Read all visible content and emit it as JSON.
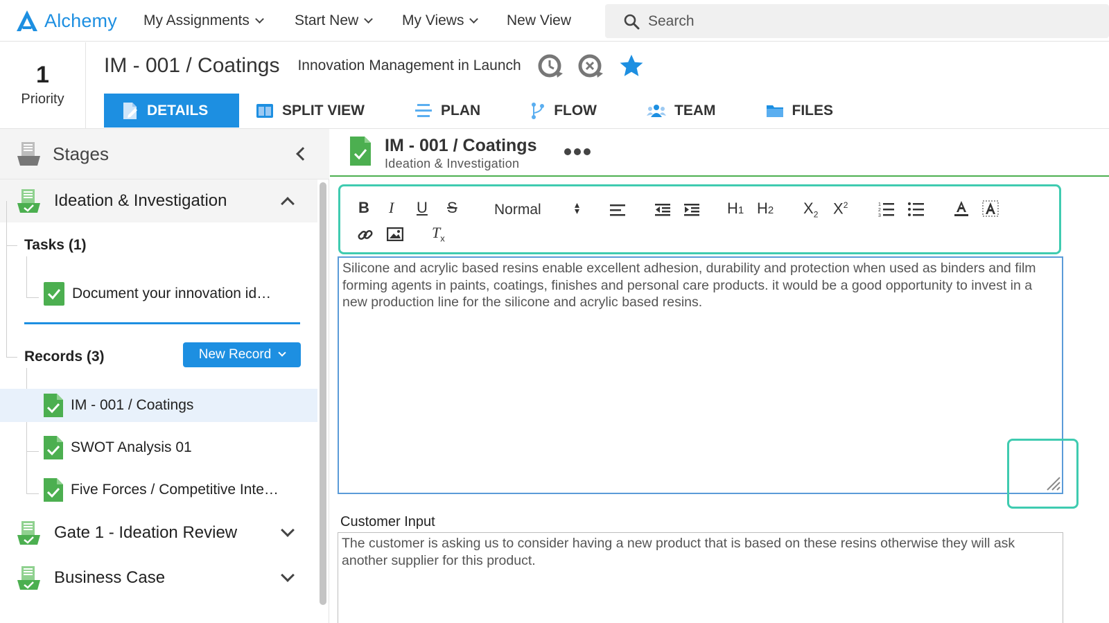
{
  "app": {
    "name": "Alchemy",
    "brand_color": "#1d8fe1"
  },
  "nav": {
    "items": [
      {
        "label": "My Assignments",
        "dropdown": true
      },
      {
        "label": "Start New",
        "dropdown": true
      },
      {
        "label": "My Views",
        "dropdown": true
      },
      {
        "label": "New View",
        "dropdown": false
      }
    ],
    "search_placeholder": "Search"
  },
  "header": {
    "priority_value": "1",
    "priority_label": "Priority",
    "title": "IM - 001 / Coatings",
    "subtitle": "Innovation Management in Launch",
    "icons": [
      "history-clock-icon",
      "cancel-clock-icon",
      "favorite-star-icon"
    ]
  },
  "tabs": [
    {
      "label": "DETAILS",
      "icon": "details-icon",
      "active": true
    },
    {
      "label": "SPLIT VIEW",
      "icon": "split-view-icon",
      "active": false
    },
    {
      "label": "PLAN",
      "icon": "plan-icon",
      "active": false
    },
    {
      "label": "FLOW",
      "icon": "flow-icon",
      "active": false
    },
    {
      "label": "TEAM",
      "icon": "team-icon",
      "active": false
    },
    {
      "label": "FILES",
      "icon": "folder-icon",
      "active": false
    }
  ],
  "sidebar": {
    "title": "Stages",
    "stages": [
      {
        "label": "Ideation & Investigation",
        "expanded": true
      },
      {
        "label": "Gate 1 - Ideation Review",
        "expanded": false
      },
      {
        "label": "Business Case",
        "expanded": false
      }
    ],
    "tasks_label": "Tasks (1)",
    "tasks": [
      {
        "label": "Document your innovation id…"
      }
    ],
    "records_label": "Records (3)",
    "new_record_label": "New Record",
    "records": [
      {
        "label": "IM - 001 / Coatings",
        "selected": true
      },
      {
        "label": "SWOT Analysis 01",
        "selected": false
      },
      {
        "label": "Five Forces / Competitive Inte…",
        "selected": false
      }
    ]
  },
  "record": {
    "title": "IM - 001 / Coatings",
    "stage": "Ideation & Investigation",
    "status_color": "#4caf50"
  },
  "toolbar": {
    "bold": "B",
    "italic": "I",
    "underline": "U",
    "strike": "S",
    "format_value": "Normal",
    "h1": "H1",
    "h2": "H2",
    "subscript": "X2",
    "superscript": "X2",
    "clear": "Tx"
  },
  "editor": {
    "text": "Silicone and acrylic based resins enable excellent adhesion, durability and protection when used as binders and film forming agents in paints, coatings, finishes and personal care products. it would be a good opportunity to invest in a new production line for the silicone and acrylic based resins."
  },
  "customer_input": {
    "label": "Customer Input",
    "text": "The customer is asking us to consider having a new product that is based on these resins otherwise they will ask another supplier for this product."
  },
  "highlight_color": "#3fcbb0"
}
